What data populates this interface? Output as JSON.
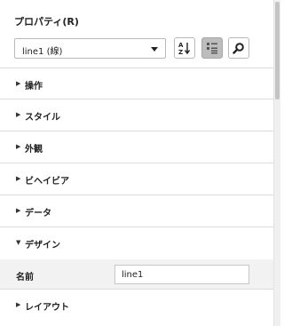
{
  "panel": {
    "title": "プロパティ(R)",
    "object_select": {
      "value": "line1 (線)"
    },
    "toolbar": {
      "sort_icon": "sort-alphabetical-icon",
      "category_icon": "categorized-view-icon",
      "search_icon": "search-icon"
    },
    "sections": [
      {
        "label": "操作",
        "expanded": false
      },
      {
        "label": "スタイル",
        "expanded": false
      },
      {
        "label": "外観",
        "expanded": false
      },
      {
        "label": "ビヘイビア",
        "expanded": false
      },
      {
        "label": "データ",
        "expanded": false
      },
      {
        "label": "デザイン",
        "expanded": true
      },
      {
        "label": "レイアウト",
        "expanded": false
      }
    ],
    "arrows": {
      "collapsed": "▶",
      "expanded": "▼"
    },
    "design_properties": [
      {
        "label": "名前",
        "value": "line1"
      }
    ]
  },
  "colors": {
    "active_button": "#bdbdbd",
    "row_highlight": "#f2f2f2",
    "divider": "#dcdcdc"
  }
}
